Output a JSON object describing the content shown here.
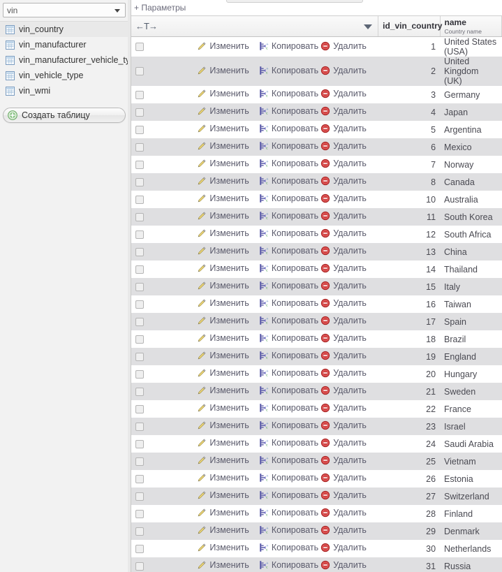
{
  "sidebar": {
    "database_select": {
      "value": "vin",
      "icon": "chevron-down-icon"
    },
    "tables": [
      {
        "label": "vin_country",
        "icon": "table-icon",
        "selected": true
      },
      {
        "label": "vin_manufacturer",
        "icon": "table-icon",
        "selected": false
      },
      {
        "label": "vin_manufacturer_vehicle_ty",
        "icon": "table-icon",
        "selected": false
      },
      {
        "label": "vin_vehicle_type",
        "icon": "table-icon",
        "selected": false
      },
      {
        "label": "vin_wmi",
        "icon": "table-icon",
        "selected": false
      }
    ],
    "create_table_button": {
      "label": "Создать таблицу",
      "icon": "plus-circle-icon"
    }
  },
  "main": {
    "options_link": "+ Параметры",
    "sort_direction_toggle": "←T→",
    "dropdown_icon": "triangle-down-icon",
    "columns": {
      "id": {
        "label": "id_vin_country"
      },
      "name": {
        "label": "name",
        "sublabel": "Country name"
      }
    },
    "row_actions": {
      "edit": {
        "label": "Изменить",
        "icon": "pencil-icon"
      },
      "copy": {
        "label": "Копировать",
        "icon": "copy-icon"
      },
      "delete": {
        "label": "Удалить",
        "icon": "delete-circle-icon"
      }
    },
    "rows": [
      {
        "id": "1",
        "name": "United States (USA)"
      },
      {
        "id": "2",
        "name": "United Kingdom (UK)"
      },
      {
        "id": "3",
        "name": "Germany"
      },
      {
        "id": "4",
        "name": "Japan"
      },
      {
        "id": "5",
        "name": "Argentina"
      },
      {
        "id": "6",
        "name": "Mexico"
      },
      {
        "id": "7",
        "name": "Norway"
      },
      {
        "id": "8",
        "name": "Canada"
      },
      {
        "id": "10",
        "name": "Australia"
      },
      {
        "id": "11",
        "name": "South Korea"
      },
      {
        "id": "12",
        "name": "South Africa"
      },
      {
        "id": "13",
        "name": "China"
      },
      {
        "id": "14",
        "name": "Thailand"
      },
      {
        "id": "15",
        "name": "Italy"
      },
      {
        "id": "16",
        "name": "Taiwan"
      },
      {
        "id": "17",
        "name": "Spain"
      },
      {
        "id": "18",
        "name": "Brazil"
      },
      {
        "id": "19",
        "name": "England"
      },
      {
        "id": "20",
        "name": "Hungary"
      },
      {
        "id": "21",
        "name": "Sweden"
      },
      {
        "id": "22",
        "name": "France"
      },
      {
        "id": "23",
        "name": "Israel"
      },
      {
        "id": "24",
        "name": "Saudi Arabia"
      },
      {
        "id": "25",
        "name": "Vietnam"
      },
      {
        "id": "26",
        "name": "Estonia"
      },
      {
        "id": "27",
        "name": "Switzerland"
      },
      {
        "id": "28",
        "name": "Finland"
      },
      {
        "id": "29",
        "name": "Denmark"
      },
      {
        "id": "30",
        "name": "Netherlands"
      },
      {
        "id": "31",
        "name": "Russia"
      }
    ]
  },
  "colors": {
    "row_alt": "#dfdfe1",
    "link": "#5a5a6b",
    "sidebar_bg": "#f2f2f2",
    "delete_red": "#cc2b2b",
    "create_green": "#53a653"
  }
}
